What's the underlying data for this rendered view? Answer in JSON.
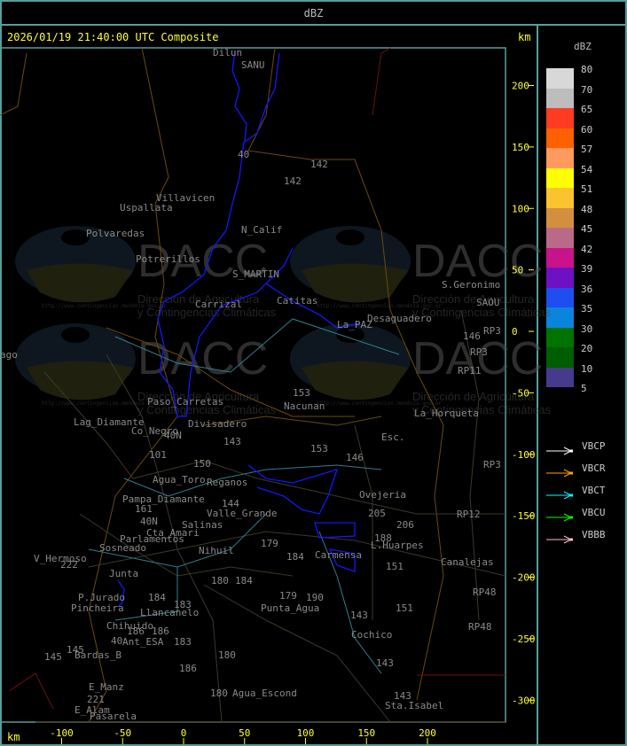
{
  "header": {
    "title": "dBZ"
  },
  "map": {
    "timestamp": "2026/01/19 21:40:00 UTC Composite",
    "unit_top": "km",
    "unit_bottom": "km",
    "x_ticks": [
      -100,
      -50,
      0,
      50,
      100,
      150,
      200
    ],
    "y_ticks": [
      200,
      150,
      100,
      50,
      0,
      -50,
      -100,
      -150,
      -200,
      -250,
      -300
    ],
    "watermark": {
      "brand": "DACC",
      "line1": "Dirección de Agricultura",
      "line2": "y Contingencias Climáticas",
      "url": "http://www.contingencias.mendoza.gov.ar"
    },
    "places": [
      "Dilun",
      "SANU",
      "40",
      "142",
      "142",
      "Villavicen",
      "Uspallata",
      "N_Calif",
      "Polvaredas",
      "Potrerillos",
      "S_MARTIN",
      "Carrizal",
      "Catitas",
      "Desaguadero",
      "La_PAZ",
      "S.Geronimo",
      "SAOU",
      "RP3",
      "146",
      "RP3",
      "RP11",
      "153",
      "Nacunan",
      "La_Horqueta",
      "Lag_Diamante",
      "Co_Negro",
      "Paso_Carretas",
      "Divisadero",
      "40N",
      "143",
      "Esc.",
      "101",
      "150",
      "146",
      "153",
      "Agua_Toro",
      "Reganos",
      "Pampa_Diamante",
      "161",
      "144",
      "Valle_Grande",
      "40N",
      "Salinas",
      "Cta_Amari",
      "Parlamentos",
      "Sosneado",
      "Nihuil",
      "179",
      "184",
      "L.Huarpes",
      "Ovejeria",
      "205",
      "206",
      "188",
      "151",
      "Carmensa",
      "Canalejas",
      "RP12",
      "RP3",
      "RP48",
      "RP48",
      "V_Hermoso",
      "222",
      "Junta",
      "P.Jurado",
      "Pincheira",
      "184",
      "180",
      "184",
      "Llancanelo",
      "183",
      "Chihuido",
      "186",
      "186",
      "Ant_ESA",
      "183",
      "40",
      "145",
      "145",
      "Bardas_B",
      "180",
      "186",
      "E_Manz",
      "221",
      "E_Alam",
      "Pasarela",
      "180",
      "Agua_Escond",
      "179",
      "190",
      "Punta_Agua",
      "143",
      "151",
      "Cochico",
      "143",
      "143",
      "Sta.Isabel",
      "ago"
    ]
  },
  "legend": {
    "title": "dBZ",
    "levels": [
      "80",
      "70",
      "65",
      "60",
      "57",
      "54",
      "51",
      "48",
      "45",
      "42",
      "39",
      "36",
      "35",
      "30",
      "20",
      "10",
      "5"
    ],
    "colors": [
      "#d8d8d8",
      "#bdbdbd",
      "#ff3b22",
      "#ff6000",
      "#ff9a5e",
      "#ffff00",
      "#fbc330",
      "#d38f3f",
      "#bb6988",
      "#c8138a",
      "#6e11c5",
      "#1e4eef",
      "#0b85dc",
      "#007300",
      "#005d00",
      "#463a8c"
    ],
    "vectors": [
      {
        "label": "VBCP",
        "color": "#ffffff"
      },
      {
        "label": "VBCR",
        "color": "#ffa500"
      },
      {
        "label": "VBCT",
        "color": "#00ffff"
      },
      {
        "label": "VBCU",
        "color": "#00ff00"
      },
      {
        "label": "VBBB",
        "color": "#ffc0cb"
      }
    ]
  }
}
